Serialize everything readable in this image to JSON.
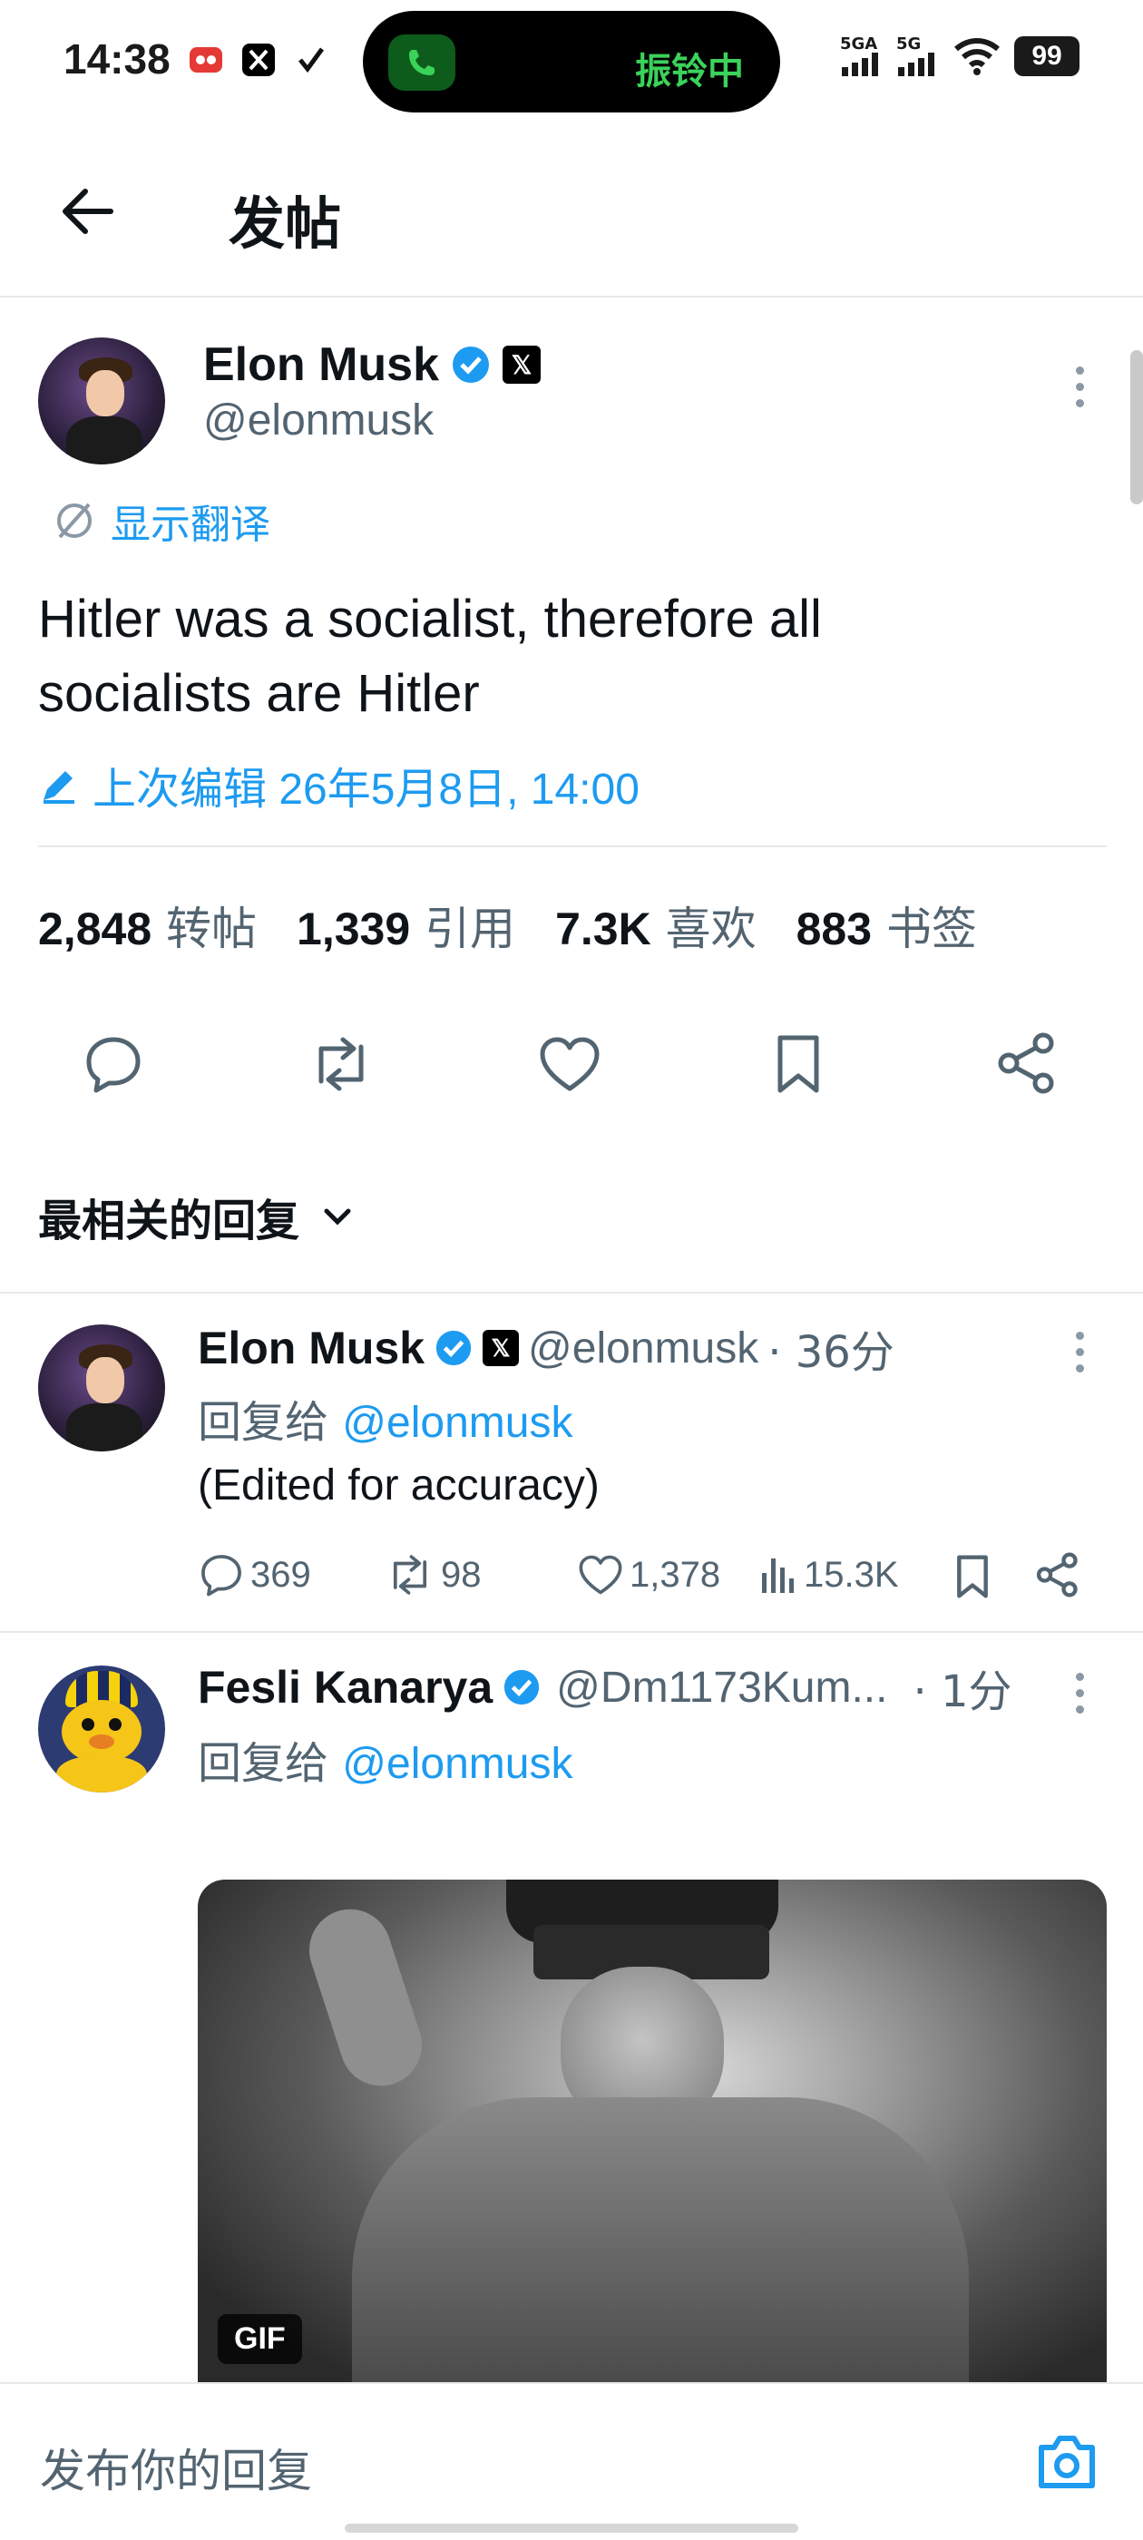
{
  "status_bar": {
    "time": "14:38",
    "call_status": "振铃中",
    "signal_1": "5GA",
    "signal_2": "5G",
    "battery": "99"
  },
  "header": {
    "title": "发帖"
  },
  "main_post": {
    "author_name": "Elon Musk",
    "author_handle": "@elonmusk",
    "x_badge": "𝕏",
    "translate_label": "显示翻译",
    "text_line1": "Hitler was a socialist, therefore all",
    "text_line2": "socialists are Hitler",
    "edited_label": "上次编辑 26年5月8日, 14:00",
    "stats": {
      "reposts_count": "2,848",
      "reposts_label": "转帖",
      "quotes_count": "1,339",
      "quotes_label": "引用",
      "likes_count": "7.3K",
      "likes_label": "喜欢",
      "bookmarks_count": "883",
      "bookmarks_label": "书签"
    }
  },
  "replies_sort": {
    "label": "最相关的回复"
  },
  "replies": [
    {
      "author_name": "Elon Musk",
      "author_handle": "@elonmusk",
      "time": "· 36分",
      "reply_to_prefix": "回复给",
      "reply_to_handle": "@elonmusk",
      "text": "(Edited for accuracy)",
      "comments": "369",
      "reposts": "98",
      "likes": "1,378",
      "views": "15.3K"
    },
    {
      "author_name": "Fesli Kanarya",
      "author_handle": "@Dm1173Kum...",
      "time": "· 1分",
      "reply_to_prefix": "回复给",
      "reply_to_handle": "@elonmusk",
      "media_label": "GIF"
    }
  ],
  "footer": {
    "reply_placeholder": "发布你的回复"
  },
  "colors": {
    "accent": "#1d9bf0",
    "text": "#0f1419",
    "muted": "#536471"
  }
}
